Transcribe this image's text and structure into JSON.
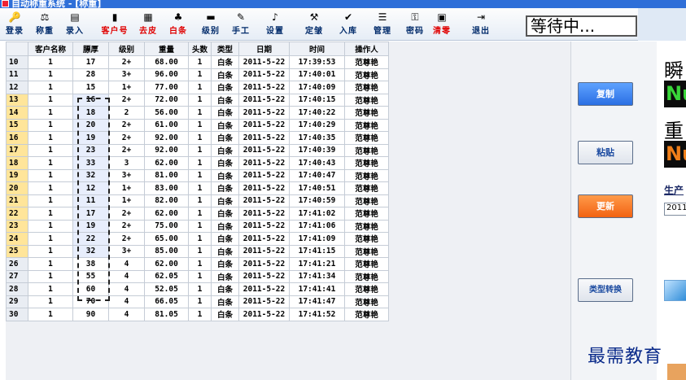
{
  "window": {
    "title": "自动称重系统 - [称重]"
  },
  "toolbar": {
    "items": [
      {
        "label": "登录",
        "icon": "key-icon",
        "glyph": "🔑",
        "red": false
      },
      {
        "label": "称重",
        "icon": "weigh-icon",
        "glyph": "⚖",
        "red": false
      },
      {
        "label": "录入",
        "icon": "entry-icon",
        "glyph": "▤",
        "red": false
      },
      {
        "label": "客户号",
        "icon": "customer-icon",
        "glyph": "▮",
        "red": true
      },
      {
        "label": "去皮",
        "icon": "tare-icon",
        "glyph": "▦",
        "red": true
      },
      {
        "label": "白条",
        "icon": "strip-icon",
        "glyph": "♣",
        "red": true
      },
      {
        "label": "级别",
        "icon": "grade-icon",
        "glyph": "▬",
        "red": false
      },
      {
        "label": "手工",
        "icon": "pen-icon",
        "glyph": "✎",
        "red": false
      },
      {
        "label": "设置",
        "icon": "bell-icon",
        "glyph": "♪",
        "red": false
      },
      {
        "label": "定皱",
        "icon": "tool-icon",
        "glyph": "⚒",
        "red": false
      },
      {
        "label": "入库",
        "icon": "checkmark-icon",
        "glyph": "✔",
        "red": false
      },
      {
        "label": "管理",
        "icon": "list-icon",
        "glyph": "☰",
        "red": false
      },
      {
        "label": "密码",
        "icon": "password-icon",
        "glyph": "⚿",
        "red": false
      },
      {
        "label": "清零",
        "icon": "clear-icon",
        "glyph": "▣",
        "red": true
      },
      {
        "label": "退出",
        "icon": "exit-icon",
        "glyph": "⇥",
        "red": false
      }
    ],
    "status": "等待中..."
  },
  "grid": {
    "columns": [
      "",
      "客户名称",
      "膘厚",
      "级别",
      "重量",
      "头数",
      "类型",
      "日期",
      "时间",
      "操作人"
    ],
    "rows": [
      [
        "10",
        "1",
        "17",
        "2+",
        "68.00",
        "1",
        "白条",
        "2011-5-22",
        "17:39:53",
        "范尊艳"
      ],
      [
        "11",
        "1",
        "28",
        "3+",
        "96.00",
        "1",
        "白条",
        "2011-5-22",
        "17:40:01",
        "范尊艳"
      ],
      [
        "12",
        "1",
        "15",
        "1+",
        "77.00",
        "1",
        "白条",
        "2011-5-22",
        "17:40:09",
        "范尊艳"
      ],
      [
        "13",
        "1",
        "16",
        "2+",
        "72.00",
        "1",
        "白条",
        "2011-5-22",
        "17:40:15",
        "范尊艳"
      ],
      [
        "14",
        "1",
        "18",
        "2",
        "56.00",
        "1",
        "白条",
        "2011-5-22",
        "17:40:22",
        "范尊艳"
      ],
      [
        "15",
        "1",
        "20",
        "2+",
        "61.00",
        "1",
        "白条",
        "2011-5-22",
        "17:40:29",
        "范尊艳"
      ],
      [
        "16",
        "1",
        "19",
        "2+",
        "92.00",
        "1",
        "白条",
        "2011-5-22",
        "17:40:35",
        "范尊艳"
      ],
      [
        "17",
        "1",
        "23",
        "2+",
        "92.00",
        "1",
        "白条",
        "2011-5-22",
        "17:40:39",
        "范尊艳"
      ],
      [
        "18",
        "1",
        "33",
        "3",
        "62.00",
        "1",
        "白条",
        "2011-5-22",
        "17:40:43",
        "范尊艳"
      ],
      [
        "19",
        "1",
        "32",
        "3+",
        "81.00",
        "1",
        "白条",
        "2011-5-22",
        "17:40:47",
        "范尊艳"
      ],
      [
        "20",
        "1",
        "12",
        "1+",
        "83.00",
        "1",
        "白条",
        "2011-5-22",
        "17:40:51",
        "范尊艳"
      ],
      [
        "21",
        "1",
        "11",
        "1+",
        "82.00",
        "1",
        "白条",
        "2011-5-22",
        "17:40:59",
        "范尊艳"
      ],
      [
        "22",
        "1",
        "17",
        "2+",
        "62.00",
        "1",
        "白条",
        "2011-5-22",
        "17:41:02",
        "范尊艳"
      ],
      [
        "23",
        "1",
        "19",
        "2+",
        "75.00",
        "1",
        "白条",
        "2011-5-22",
        "17:41:06",
        "范尊艳"
      ],
      [
        "24",
        "1",
        "22",
        "2+",
        "65.00",
        "1",
        "白条",
        "2011-5-22",
        "17:41:09",
        "范尊艳"
      ],
      [
        "25",
        "1",
        "32",
        "3+",
        "85.00",
        "1",
        "白条",
        "2011-5-22",
        "17:41:15",
        "范尊艳"
      ],
      [
        "26",
        "1",
        "38",
        "4",
        "62.00",
        "1",
        "白条",
        "2011-5-22",
        "17:41:21",
        "范尊艳"
      ],
      [
        "27",
        "1",
        "55",
        "4",
        "62.05",
        "1",
        "白条",
        "2011-5-22",
        "17:41:34",
        "范尊艳"
      ],
      [
        "28",
        "1",
        "60",
        "4",
        "52.05",
        "1",
        "白条",
        "2011-5-22",
        "17:41:41",
        "范尊艳"
      ],
      [
        "29",
        "1",
        "70",
        "4",
        "66.05",
        "1",
        "白条",
        "2011-5-22",
        "17:41:47",
        "范尊艳"
      ],
      [
        "30",
        "1",
        "90",
        "4",
        "81.05",
        "1",
        "白条",
        "2011-5-22",
        "17:41:52",
        "范尊艳"
      ]
    ]
  },
  "buttons": {
    "copy": "复制",
    "paste": "粘贴",
    "refresh": "更新",
    "convert": "类型转换"
  },
  "side": {
    "instant_label": "瞬",
    "instant_value": "Nu",
    "weight_label": "重",
    "weight_value": "Nu",
    "production_label": "生产",
    "production_date": "2011"
  },
  "watermark": "最需教育",
  "colors": {
    "titlebar": "#2f6fd8",
    "instant_value": "#39d639",
    "weight_value": "#f07f1a",
    "selected_row": "#ffe59a"
  }
}
